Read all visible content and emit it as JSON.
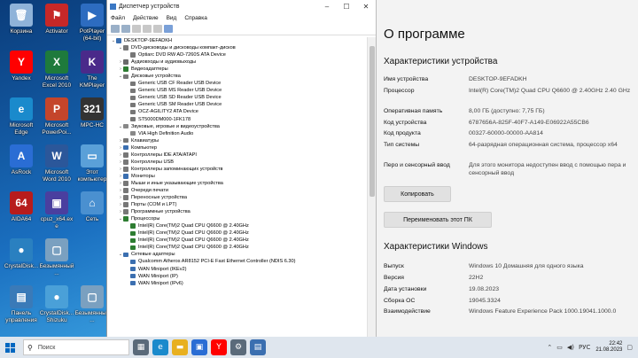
{
  "desktop": {
    "icons": [
      {
        "label": "Корзина",
        "color": "#8fb3d9",
        "glyph": "🗑"
      },
      {
        "label": "Activator",
        "color": "#c62828",
        "glyph": "⚑"
      },
      {
        "label": "PotPlayer (64-bit)",
        "color": "#2d6cc0",
        "glyph": "▶"
      },
      {
        "label": "Yandex",
        "color": "#ff0000",
        "glyph": "Y"
      },
      {
        "label": "Microsoft Excel 2010",
        "color": "#1e7a3c",
        "glyph": "X"
      },
      {
        "label": "The KMPlayer",
        "color": "#4a2a8a",
        "glyph": "K"
      },
      {
        "label": "Microsoft Edge",
        "color": "#1a8acc",
        "glyph": "e"
      },
      {
        "label": "Microsoft PowerPoi...",
        "color": "#c4452b",
        "glyph": "P"
      },
      {
        "label": "MPC-HC",
        "color": "#333333",
        "glyph": "321"
      },
      {
        "label": "AsRock",
        "color": "#2a6dd4",
        "glyph": "A"
      },
      {
        "label": "Microsoft Word 2010",
        "color": "#2b579a",
        "glyph": "W"
      },
      {
        "label": "Этот компьютер",
        "color": "#5aa0d8",
        "glyph": "▭"
      },
      {
        "label": "AIDA64",
        "color": "#b71c1c",
        "glyph": "64"
      },
      {
        "label": "cpuz_x64.exe",
        "color": "#4a3f9f",
        "glyph": "▣"
      },
      {
        "label": "Сеть",
        "color": "#4a90d0",
        "glyph": "⌂"
      },
      {
        "label": "CrystalDisk...",
        "color": "#2a80c0",
        "glyph": "●"
      },
      {
        "label": "Безымянный...",
        "color": "#7aa0c0",
        "glyph": "▢"
      },
      {
        "label": "Панель управления",
        "color": "#3a7ab8",
        "glyph": "▤"
      },
      {
        "label": "CrystalDisk... Shizuku",
        "color": "#4aa0d8",
        "glyph": "●"
      },
      {
        "label": "Безымянный...",
        "color": "#7aa0c0",
        "glyph": "▢"
      }
    ]
  },
  "devmgr": {
    "title": "Диспетчер устройств",
    "menu": [
      "Файл",
      "Действие",
      "Вид",
      "Справка"
    ],
    "tree": [
      {
        "level": 0,
        "expanded": true,
        "label": "DESKTOP-9EFADKH",
        "icon": "#3b6fb0"
      },
      {
        "level": 1,
        "expanded": true,
        "label": "DVD-дисководы и дисководы компакт-дисков",
        "icon": "#777777"
      },
      {
        "level": 2,
        "expanded": null,
        "label": "Optiarc DVD RW AD-7260S ATA Device",
        "icon": "#777777"
      },
      {
        "level": 1,
        "expanded": false,
        "label": "Аудиовходы и аудиовыходы",
        "icon": "#6a6a6a"
      },
      {
        "level": 1,
        "expanded": false,
        "label": "Видеоадаптеры",
        "icon": "#2e7d32"
      },
      {
        "level": 1,
        "expanded": true,
        "label": "Дисковые устройства",
        "icon": "#777777"
      },
      {
        "level": 2,
        "expanded": null,
        "label": "Generic USB CF Reader USB Device",
        "icon": "#777777"
      },
      {
        "level": 2,
        "expanded": null,
        "label": "Generic USB MS Reader USB Device",
        "icon": "#777777"
      },
      {
        "level": 2,
        "expanded": null,
        "label": "Generic USB SD Reader USB Device",
        "icon": "#777777"
      },
      {
        "level": 2,
        "expanded": null,
        "label": "Generic USB SM Reader USB Device",
        "icon": "#777777"
      },
      {
        "level": 2,
        "expanded": null,
        "label": "OCZ-AGILITY2 ATA Device",
        "icon": "#777777"
      },
      {
        "level": 2,
        "expanded": null,
        "label": "ST5000DM000-1FK178",
        "icon": "#777777"
      },
      {
        "level": 1,
        "expanded": true,
        "label": "Звуковые, игровые и видеоустройства",
        "icon": "#888888"
      },
      {
        "level": 2,
        "expanded": null,
        "label": "VIA High Definition Audio",
        "icon": "#888888"
      },
      {
        "level": 1,
        "expanded": false,
        "label": "Клавиатуры",
        "icon": "#777777"
      },
      {
        "level": 1,
        "expanded": false,
        "label": "Компьютер",
        "icon": "#3b6fb0"
      },
      {
        "level": 1,
        "expanded": false,
        "label": "Контроллеры IDE ATA/ATAPI",
        "icon": "#777777"
      },
      {
        "level": 1,
        "expanded": false,
        "label": "Контроллеры USB",
        "icon": "#777777"
      },
      {
        "level": 1,
        "expanded": false,
        "label": "Контроллеры запоминающих устройств",
        "icon": "#777777"
      },
      {
        "level": 1,
        "expanded": false,
        "label": "Мониторы",
        "icon": "#3b6fb0"
      },
      {
        "level": 1,
        "expanded": false,
        "label": "Мыши и иные указывающие устройства",
        "icon": "#777777"
      },
      {
        "level": 1,
        "expanded": false,
        "label": "Очереди печати",
        "icon": "#777777"
      },
      {
        "level": 1,
        "expanded": false,
        "label": "Переносные устройства",
        "icon": "#777777"
      },
      {
        "level": 1,
        "expanded": false,
        "label": "Порты (COM и LPT)",
        "icon": "#777777"
      },
      {
        "level": 1,
        "expanded": false,
        "label": "Программные устройства",
        "icon": "#777777"
      },
      {
        "level": 1,
        "expanded": true,
        "label": "Процессоры",
        "icon": "#2e7d32"
      },
      {
        "level": 2,
        "expanded": null,
        "label": "Intel(R) Core(TM)2 Quad CPU    Q6600  @ 2.40GHz",
        "icon": "#2e7d32"
      },
      {
        "level": 2,
        "expanded": null,
        "label": "Intel(R) Core(TM)2 Quad CPU    Q6600  @ 2.40GHz",
        "icon": "#2e7d32"
      },
      {
        "level": 2,
        "expanded": null,
        "label": "Intel(R) Core(TM)2 Quad CPU    Q6600  @ 2.40GHz",
        "icon": "#2e7d32"
      },
      {
        "level": 2,
        "expanded": null,
        "label": "Intel(R) Core(TM)2 Quad CPU    Q6600  @ 2.40GHz",
        "icon": "#2e7d32"
      },
      {
        "level": 1,
        "expanded": true,
        "label": "Сетевые адаптеры",
        "icon": "#3b6fb0"
      },
      {
        "level": 2,
        "expanded": null,
        "label": "Qualcomm Atheros AR8152 PCI-E Fast Ethernet Controller (NDIS 6.30)",
        "icon": "#3b6fb0"
      },
      {
        "level": 2,
        "expanded": null,
        "label": "WAN Miniport (IKEv2)",
        "icon": "#3b6fb0"
      },
      {
        "level": 2,
        "expanded": null,
        "label": "WAN Miniport (IP)",
        "icon": "#3b6fb0"
      },
      {
        "level": 2,
        "expanded": null,
        "label": "WAN Miniport (IPv6)",
        "icon": "#3b6fb0"
      }
    ]
  },
  "about": {
    "title": "О программе",
    "device_section": "Характеристики устройства",
    "device_specs": [
      {
        "key": "Имя устройства",
        "value": "DESKTOP-9EFADKH"
      },
      {
        "key": "Процессор",
        "value": "Intel(R) Core(TM)2 Quad CPU    Q6600  @ 2.40GHz   2.40 GHz"
      },
      {
        "key": "Оперативная память",
        "value": "8,00 ГБ (доступно: 7,75 ГБ)"
      },
      {
        "key": "Код устройства",
        "value": "6787656A-825F-40F7-A149-E06922A55CB6"
      },
      {
        "key": "Код продукта",
        "value": "00327-60000-00000-AA814"
      },
      {
        "key": "Тип системы",
        "value": "64-разрядная операционная система, процессор x64"
      },
      {
        "key": "Перо и сенсорный ввод",
        "value": "Для этого монитора недоступен ввод с помощью пера и сенсорный ввод"
      }
    ],
    "copy_label": "Копировать",
    "rename_label": "Переименовать этот ПК",
    "windows_section": "Характеристики Windows",
    "windows_specs": [
      {
        "key": "Выпуск",
        "value": "Windows 10 Домашняя для одного языка"
      },
      {
        "key": "Версия",
        "value": "22H2"
      },
      {
        "key": "Дата установки",
        "value": "19.08.2023"
      },
      {
        "key": "Сборка ОС",
        "value": "19045.3324"
      },
      {
        "key": "Взаимодействие",
        "value": "Windows Feature Experience Pack 1000.19041.1000.0"
      }
    ]
  },
  "taskbar": {
    "search_placeholder": "Поиск",
    "apps": [
      {
        "name": "task-view",
        "color": "#5a6a7a",
        "glyph": "▦"
      },
      {
        "name": "edge",
        "color": "#1a8acc",
        "glyph": "e"
      },
      {
        "name": "explorer",
        "color": "#e8b020",
        "glyph": "▬"
      },
      {
        "name": "store",
        "color": "#2a6dd4",
        "glyph": "▣"
      },
      {
        "name": "yandex",
        "color": "#ff0000",
        "glyph": "Y"
      },
      {
        "name": "settings",
        "color": "#5a6a7a",
        "glyph": "⚙"
      },
      {
        "name": "device-manager",
        "color": "#3b6fb0",
        "glyph": "▤"
      }
    ],
    "time": "22:42",
    "date": "21.08.2023",
    "lang": "РУС"
  }
}
